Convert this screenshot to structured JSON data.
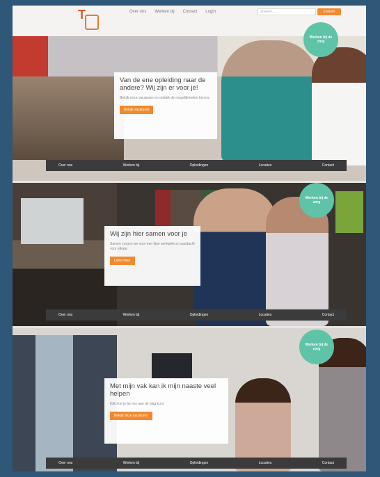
{
  "header": {
    "nav": [
      "Over ons",
      "Werken bij",
      "Contact",
      "Login"
    ],
    "search_placeholder": "Zoeken...",
    "search_button": "Zoeken"
  },
  "panels": [
    {
      "badge": "Werken bij de zorg",
      "heading": "Van de ene opleiding naar de andere? Wij zijn er voor je!",
      "body": "Bekijk onze vacatures en ontdek de mogelijkheden bij ons.",
      "button": "Bekijk vacatures",
      "nav": [
        "Over ons",
        "Werken bij",
        "Opleidingen",
        "Locaties",
        "Contact"
      ]
    },
    {
      "badge": "Werken bij de zorg",
      "heading": "Wij zijn hier samen voor je",
      "body": "Samen zorgen we voor een fijne werkplek en aandacht voor elkaar.",
      "button": "Lees meer",
      "nav": [
        "Over ons",
        "Werken bij",
        "Opleidingen",
        "Locaties",
        "Contact"
      ]
    },
    {
      "badge": "Werken bij de zorg",
      "heading": "Met mijn vak kan ik mijn naaste veel helpen",
      "body": "Kijk hoe je bij ons aan de slag kunt.",
      "button": "Bekijk onze vacatures",
      "nav": [
        "Over ons",
        "Werken bij",
        "Opleidingen",
        "Locaties",
        "Contact"
      ]
    }
  ]
}
